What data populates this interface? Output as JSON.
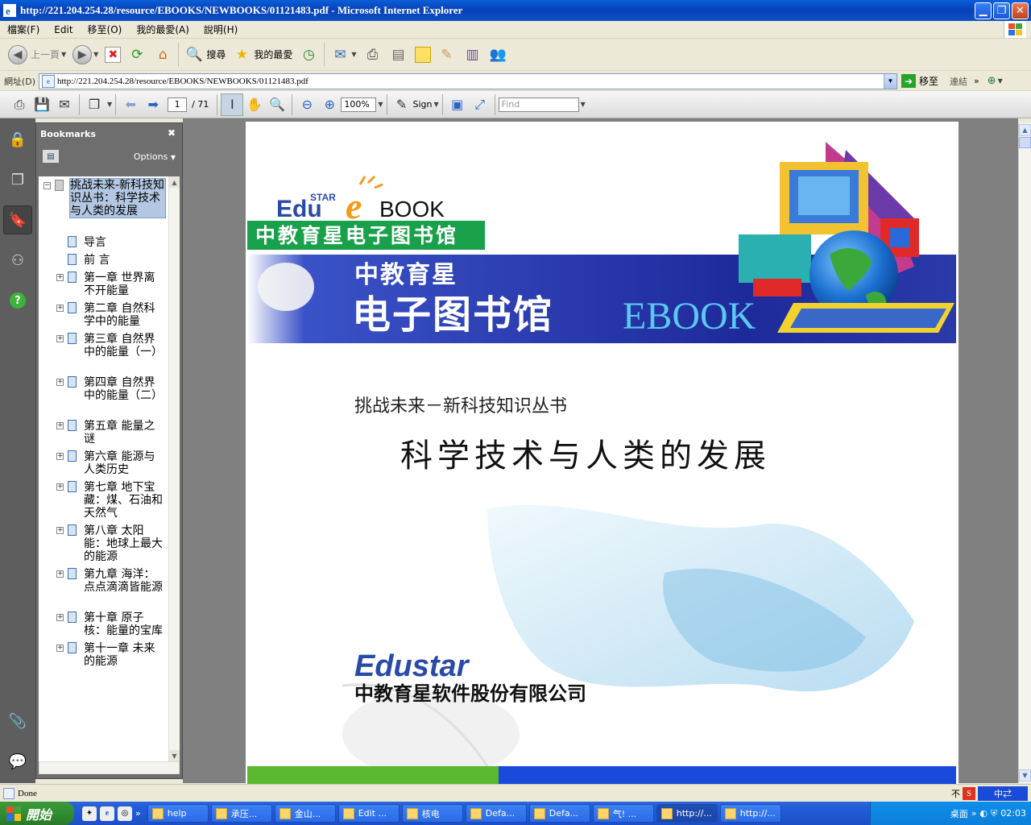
{
  "window": {
    "title": "http://221.204.254.28/resource/EBOOKS/NEWBOOKS/01121483.pdf - Microsoft Internet Explorer"
  },
  "menu": [
    "檔案(F)",
    "Edit",
    "移至(O)",
    "我的最愛(A)",
    "說明(H)"
  ],
  "toolbar": {
    "back": "上一頁",
    "search": "搜尋",
    "favorites": "我的最愛"
  },
  "address": {
    "label": "網址(D)",
    "url": "http://221.204.254.28/resource/EBOOKS/NEWBOOKS/01121483.pdf",
    "go": "移至",
    "links": "連結"
  },
  "acrobat": {
    "page_current": "1",
    "page_total": "/ 71",
    "zoom": "100%",
    "sign": "Sign",
    "find_placeholder": "Find"
  },
  "bookmarks": {
    "title": "Bookmarks",
    "options": "Options",
    "root": "挑战未来-新科技知识丛书：科学技术与人类的发展",
    "items": [
      {
        "label": "导言",
        "expandable": false
      },
      {
        "label": "前 言",
        "expandable": false
      },
      {
        "label": "第一章 世界离不开能量",
        "expandable": true
      },
      {
        "label": "第二章 自然科学中的能量",
        "expandable": true
      },
      {
        "label": "第三章 自然界中的能量（一）",
        "expandable": true
      },
      {
        "label": "第四章 自然界中的能量（二）",
        "expandable": true
      },
      {
        "label": "第五章 能量之谜",
        "expandable": true
      },
      {
        "label": "第六章 能源与人类历史",
        "expandable": true
      },
      {
        "label": "第七章 地下宝藏：煤、石油和天然气",
        "expandable": true
      },
      {
        "label": "第八章 太阳能：地球上最大的能源",
        "expandable": true
      },
      {
        "label": "第九章 海洋：点点滴滴皆能源",
        "expandable": true
      },
      {
        "label": "第十章 原子核：能量的宝库",
        "expandable": true
      },
      {
        "label": "第十一章 未来的能源",
        "expandable": true
      }
    ]
  },
  "page": {
    "logo_edu": "Edu",
    "logo_star": "STAR",
    "logo_e": "e",
    "logo_book": "BOOK",
    "green_banner": "中教育星电子图书馆",
    "blue_line1": "中教育星",
    "blue_line2": "电子图书馆",
    "blue_ebook": "EBOOK",
    "series": "挑战未来－新科技知识丛书",
    "title": "科学技术与人类的发展",
    "publisher_logo": "Edustar",
    "publisher": "中教育星软件股份有限公司"
  },
  "status": {
    "text": "Done"
  },
  "taskbar": {
    "start": "開始",
    "tasks": [
      "help",
      "承压...",
      "金山...",
      "Edit ...",
      "核电",
      "Defa...",
      "Defa...",
      "气! ...",
      "http://...",
      "http://..."
    ],
    "tray_text": "桌面",
    "clock": "02:03"
  }
}
